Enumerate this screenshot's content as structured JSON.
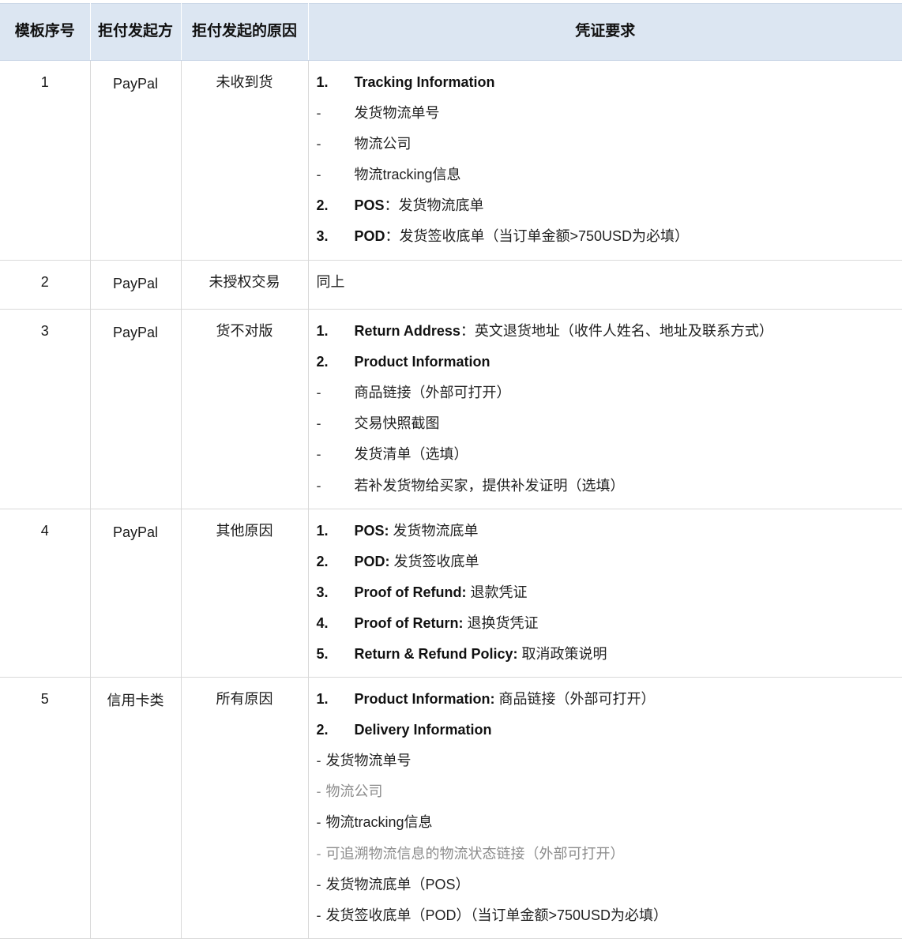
{
  "table": {
    "headers": [
      {
        "id": "template-no",
        "label": "模板序号"
      },
      {
        "id": "initiator",
        "label": "拒付发起方"
      },
      {
        "id": "reason",
        "label": "拒付发起的原因"
      },
      {
        "id": "evidence",
        "label": "凭证要求"
      }
    ],
    "header_bg": "#dce6f2",
    "border_color": "#d9d9d9",
    "muted_text_color": "#8c8c8c",
    "rows": [
      {
        "index": "1",
        "initiator": "PayPal",
        "reason": "未收到货",
        "evidence": {
          "kind": "list",
          "lines": [
            {
              "style": "numbered",
              "marker": "1.",
              "term": "Tracking Information",
              "rest": "",
              "muted": false
            },
            {
              "style": "dashed",
              "marker": "-",
              "term": "",
              "rest": "发货物流单号",
              "muted": false
            },
            {
              "style": "dashed",
              "marker": "-",
              "term": "",
              "rest": "物流公司",
              "muted": false
            },
            {
              "style": "dashed",
              "marker": "-",
              "term": "",
              "rest": "物流tracking信息",
              "muted": false
            },
            {
              "style": "numbered",
              "marker": "2.",
              "term": "POS",
              "rest": "：发货物流底单",
              "muted": false
            },
            {
              "style": "numbered",
              "marker": "3.",
              "term": "POD",
              "rest": "：发货签收底单（当订单金额>750USD为必填）",
              "muted": false
            }
          ]
        }
      },
      {
        "index": "2",
        "initiator": "PayPal",
        "reason": "未授权交易",
        "evidence": {
          "kind": "text",
          "text": "同上"
        }
      },
      {
        "index": "3",
        "initiator": "PayPal",
        "reason": "货不对版",
        "evidence": {
          "kind": "list",
          "lines": [
            {
              "style": "numbered",
              "marker": "1.",
              "term": "Return Address",
              "rest": "：英文退货地址（收件人姓名、地址及联系方式）",
              "muted": false
            },
            {
              "style": "numbered",
              "marker": "2.",
              "term": "Product Information",
              "rest": "",
              "muted": false
            },
            {
              "style": "dashed",
              "marker": "-",
              "term": "",
              "rest": "商品链接（外部可打开）",
              "muted": false
            },
            {
              "style": "dashed",
              "marker": "-",
              "term": "",
              "rest": "交易快照截图",
              "muted": false
            },
            {
              "style": "dashed",
              "marker": "-",
              "term": "",
              "rest": "发货清单（选填）",
              "muted": false
            },
            {
              "style": "dashed",
              "marker": "-",
              "term": "",
              "rest": "若补发货物给买家，提供补发证明（选填）",
              "muted": false
            }
          ]
        }
      },
      {
        "index": "4",
        "initiator": "PayPal",
        "reason": "其他原因",
        "evidence": {
          "kind": "list",
          "lines": [
            {
              "style": "numbered",
              "marker": "1.",
              "term": "POS:",
              "rest": " 发货物流底单",
              "muted": false
            },
            {
              "style": "numbered",
              "marker": "2.",
              "term": "POD:",
              "rest": " 发货签收底单",
              "muted": false
            },
            {
              "style": "numbered",
              "marker": "3.",
              "term": "Proof of Refund:",
              "rest": " 退款凭证",
              "muted": false
            },
            {
              "style": "numbered",
              "marker": "4.",
              "term": "Proof of Return:",
              "rest": " 退换货凭证",
              "muted": false
            },
            {
              "style": "numbered",
              "marker": "5.",
              "term": "Return & Refund Policy:",
              "rest": " 取消政策说明",
              "muted": false
            }
          ]
        }
      },
      {
        "index": "5",
        "initiator": "信用卡类",
        "reason": "所有原因",
        "evidence": {
          "kind": "list",
          "lines": [
            {
              "style": "numbered",
              "marker": "1.",
              "term": "Product Information:",
              "rest": " 商品链接（外部可打开）",
              "muted": false
            },
            {
              "style": "numbered",
              "marker": "2.",
              "term": "Delivery Information",
              "rest": "",
              "muted": false
            },
            {
              "style": "tight",
              "marker": "-",
              "term": "",
              "rest": "发货物流单号",
              "muted": false
            },
            {
              "style": "tight",
              "marker": "-",
              "term": "",
              "rest": "物流公司",
              "muted": true
            },
            {
              "style": "tight",
              "marker": "-",
              "term": "",
              "rest": "物流tracking信息",
              "muted": false
            },
            {
              "style": "tight",
              "marker": "-",
              "term": "",
              "rest": "可追溯物流信息的物流状态链接（外部可打开）",
              "muted": true
            },
            {
              "style": "tight",
              "marker": "-",
              "term": "",
              "rest": "发货物流底单（POS）",
              "muted": false
            },
            {
              "style": "tight",
              "marker": "-",
              "term": "",
              "rest": "发货签收底单（POD）（当订单金额>750USD为必填）",
              "muted": false
            }
          ]
        }
      }
    ]
  }
}
